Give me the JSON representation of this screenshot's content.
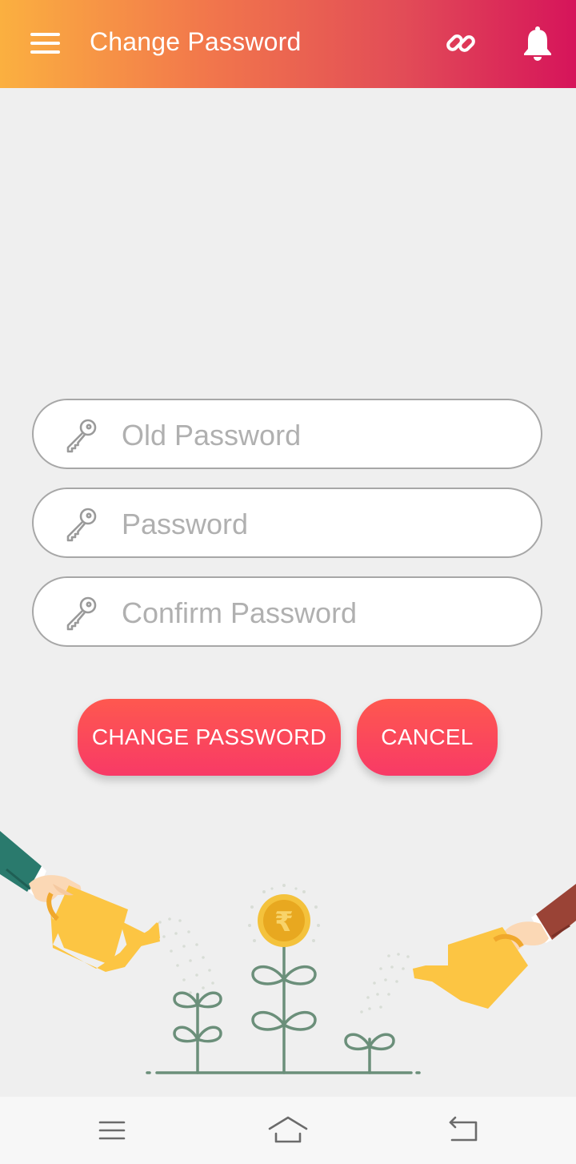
{
  "appbar": {
    "title": "Change Password",
    "gradient_colors": [
      "#fbb040",
      "#f2784b",
      "#e24c57",
      "#d6145a"
    ],
    "icons": [
      "menu-icon",
      "link-icon",
      "bell-icon"
    ]
  },
  "form": {
    "old_password": {
      "placeholder": "Old Password",
      "value": "",
      "icon": "key-icon"
    },
    "password": {
      "placeholder": "Password",
      "value": "",
      "icon": "key-icon"
    },
    "confirm_password": {
      "placeholder": "Confirm Password",
      "value": "",
      "icon": "key-icon"
    }
  },
  "buttons": {
    "change_password": "CHANGE PASSWORD",
    "cancel": "CANCEL",
    "color": "#f83a66"
  },
  "illustration": {
    "coin_symbol": "₹"
  },
  "system_nav": {
    "icons": [
      "recents-icon",
      "home-icon",
      "back-icon"
    ]
  }
}
